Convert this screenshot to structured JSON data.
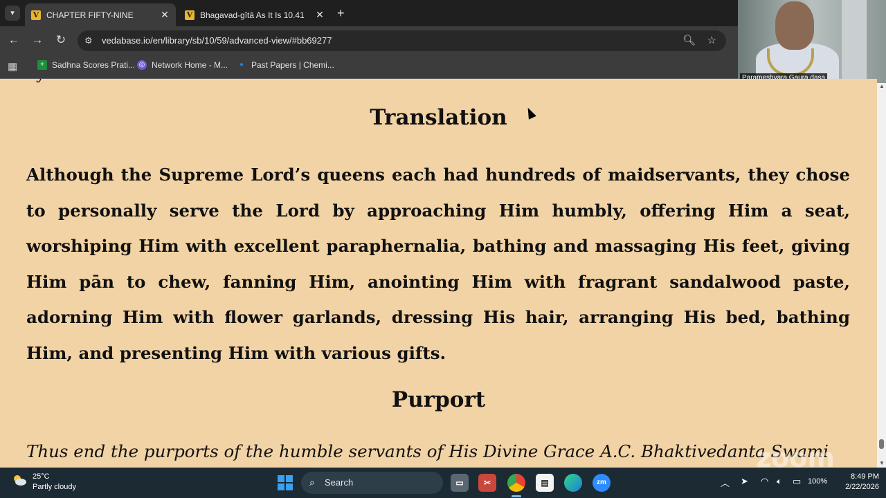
{
  "browser": {
    "tabs": [
      {
        "title": "CHAPTER FIFTY-NINE",
        "favicon": "V",
        "active": true
      },
      {
        "title": "Bhagavad-gītā As It Is 10.41",
        "favicon": "V",
        "active": false
      }
    ],
    "url": "vedabase.io/en/library/sb/10/59/advanced-view/#bb69277",
    "bookmarks": [
      {
        "label": "Sadhna Scores Prati...",
        "icon": "plus-sheet-icon",
        "color": "#1e8e3e"
      },
      {
        "label": "Network Home - M...",
        "icon": "network-icon",
        "color": "#6b5bd6"
      },
      {
        "label": "Past Papers | Chemi...",
        "icon": "drop-icon",
        "color": "#2b7bd6"
      }
    ]
  },
  "video": {
    "participant_name": "Parameshvara Gaura dasa"
  },
  "page": {
    "background": "#f2d3a5",
    "translation_heading": "Translation",
    "translation_text": "Although the Supreme Lord’s queens each had hundreds of maidservants, they chose to personally serve the Lord by approaching Him humbly, offering Him a seat, worshiping Him with excellent paraphernalia, bathing and massaging His feet, giving Him pān to chew, fanning Him, anointing Him with fragrant sandalwood paste, adorning Him with flower garlands, dressing His hair, arranging His bed, bathing Him, and presenting Him with various gifts.",
    "purport_heading": "Purport",
    "purport_text": "Thus end the purports of the humble servants of His Divine Grace A.C. Bhaktivedanta Swami",
    "watermark": "zoom"
  },
  "taskbar": {
    "temperature": "25°C",
    "condition": "Partly cloudy",
    "search_label": "Search",
    "battery": "100%",
    "time": "8:49 PM",
    "date": "2/22/2026"
  }
}
